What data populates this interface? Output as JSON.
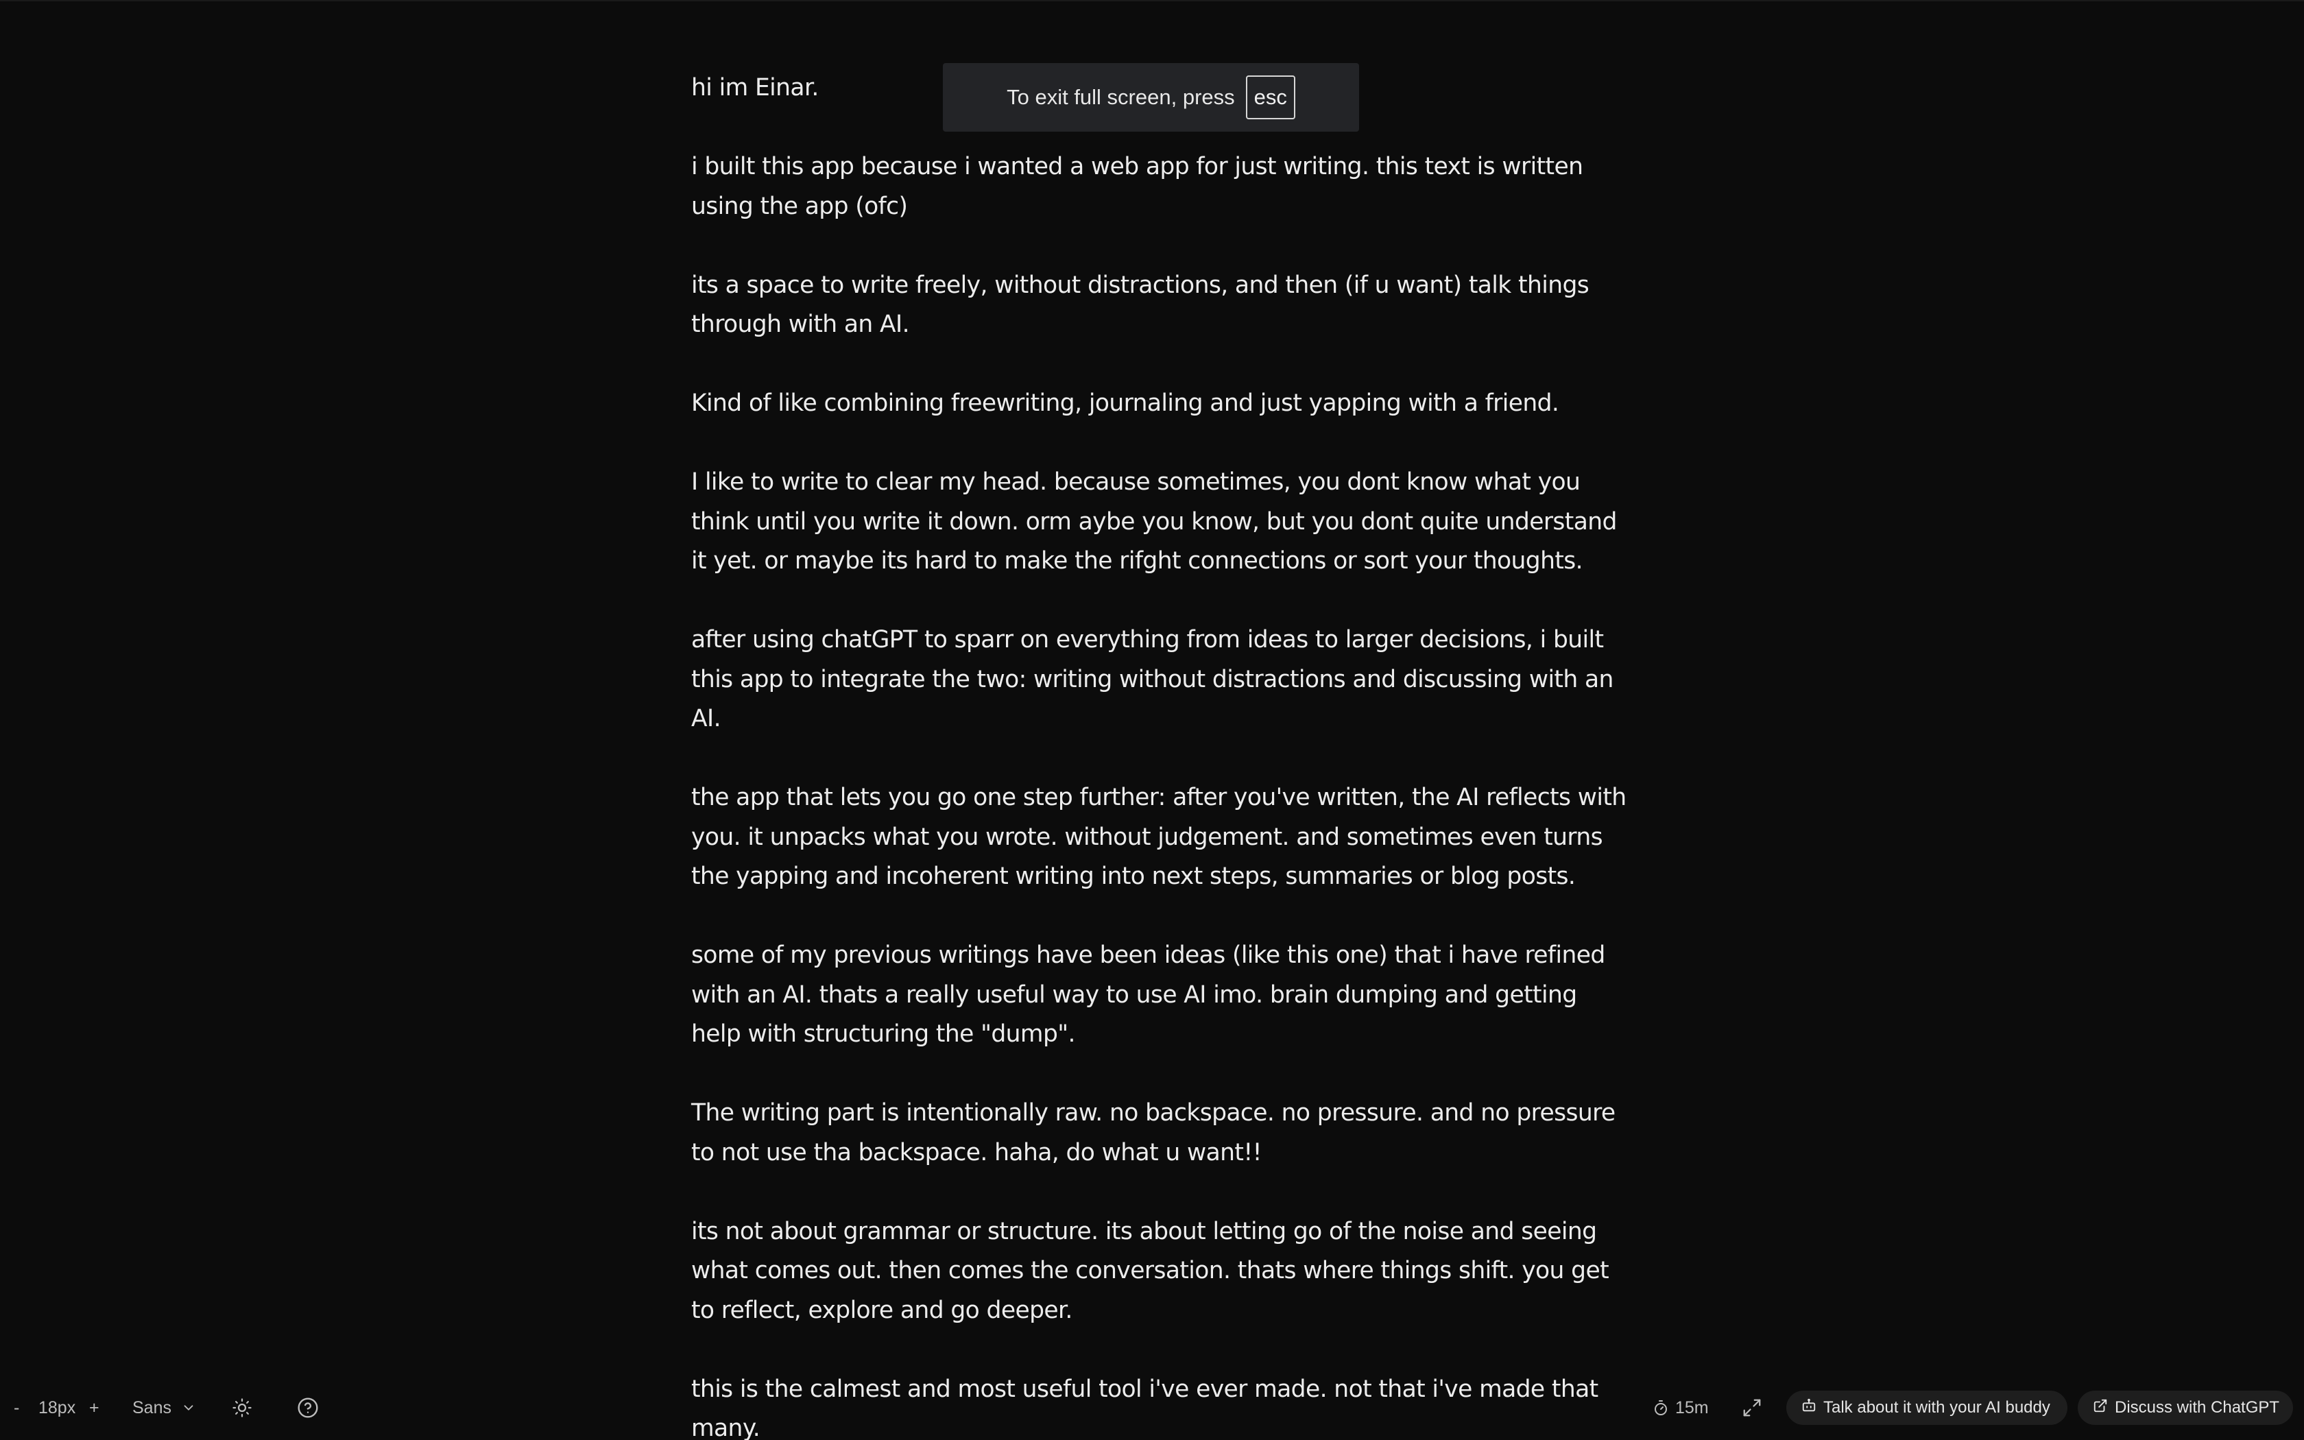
{
  "fullscreen_notice": {
    "text": "To exit full screen, press",
    "key": "esc"
  },
  "editor": {
    "paragraphs": [
      "hi im Einar.",
      "i built this app because i wanted a web app for just writing. this text is written using the app (ofc)",
      "its a space to write freely, without distractions, and then (if u want) talk things through with an AI.",
      "Kind of like combining freewriting, journaling and just yapping with a friend.",
      "I like to write to clear my head. because sometimes, you dont know what you think until you write it down. orm aybe you know, but you dont quite understand it yet. or maybe its hard to make the rifght connections or sort your thoughts.",
      "after using chatGPT to sparr on everything from ideas to larger decisions, i built this app to integrate the two: writing without distractions and discussing with an AI.",
      "the app that lets you go one step further: after you've written, the AI reflects with you. it unpacks what you wrote. without judgement. and sometimes even turns the yapping and incoherent writing into next steps, summaries or blog posts.",
      "some of my previous writings have been ideas (like this one) that i have refined with an AI. thats a really useful way to use AI imo. brain dumping and getting help with structuring the \"dump\".",
      "The writing part is intentionally raw. no backspace. no pressure. and no pressure to not use tha backspace. haha, do what u want!!",
      "its not about grammar or structure. its about letting go of the noise and seeing what comes out. then comes the conversation. thats where things shift. you get to reflect, explore and go deeper.",
      "this is the calmest and most useful tool i've ever made. not that i've made that many."
    ]
  },
  "toolbar": {
    "font_decrease": "-",
    "font_size": "18px",
    "font_increase": "+",
    "font_family": "Sans",
    "timer": "15m",
    "ai_buddy_label": "Talk about it with your AI buddy",
    "chatgpt_label": "Discuss with ChatGPT",
    "icons": {
      "font_family_dropdown": "chevron-down-icon",
      "theme": "sun-icon",
      "help": "help-circle-icon",
      "timer": "timer-icon",
      "fullscreen": "expand-icon",
      "ai_buddy": "bot-icon",
      "chatgpt": "external-link-icon"
    }
  },
  "colors": {
    "background": "#0c0c0c",
    "text": "#ededed",
    "toolbar_text": "#bdbdbd",
    "pill_background": "#1e1e1e",
    "toast_background": "#232427"
  }
}
